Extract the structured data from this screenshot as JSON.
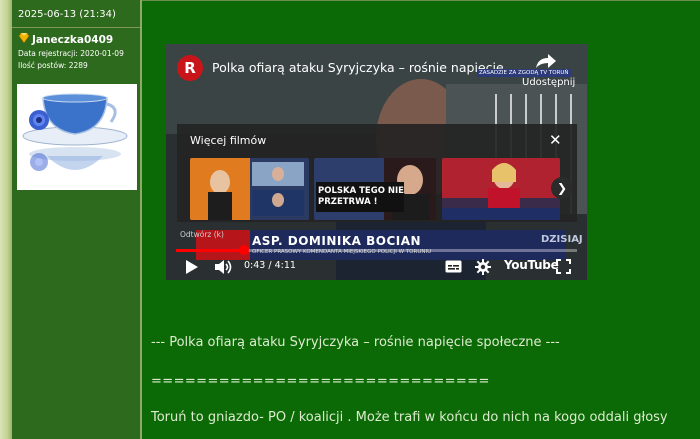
{
  "post": {
    "date": "2025-06-13 (21:34)",
    "author": {
      "username": "Janeczka0409",
      "registration": "Data rejestracji: 2020-01-09",
      "post_count": "Ilość postów: 2289",
      "rank_icon": "diamond-rank-icon",
      "avatar": "teacup-with-cornflower-image"
    },
    "lines": [
      "--- Polka ofiarą ataku Syryjczyka – rośnie napięcie społeczne ---",
      "==============================",
      "Toruń to gniazdo- PO / koalicji . Może trafi w końcu do nich na kogo oddali głosy"
    ]
  },
  "video": {
    "channel_logo": "R",
    "title": "Polka ofiarą ataku Syryjczyka – rośnie napięcie...",
    "share_label": "Udostępnij",
    "badge": "ZASADZIE ZA ZGODĄ TV TORUŃ",
    "more_videos": {
      "title": "Więcej filmów",
      "close_icon": "close-icon",
      "next_icon": "chevron-right-icon",
      "thumbnails": [
        {
          "caption": ""
        },
        {
          "caption": "POLSKA TEGO NIE PRZETRWA !"
        },
        {
          "caption": ""
        }
      ]
    },
    "lower_third": {
      "name": "ASP. DOMINIKA BOCIAN",
      "subtitle": "OFICER PRASOWY KOMENDANTA MIEJSKIEGO POLICJI W TORUNIU",
      "tag": "DZISIAJ"
    },
    "replay_label": "Odtwórz (k)",
    "time": "0:43 / 4:11",
    "progress": 0.17,
    "brand": "YouTube",
    "accent": "#ff0000"
  }
}
